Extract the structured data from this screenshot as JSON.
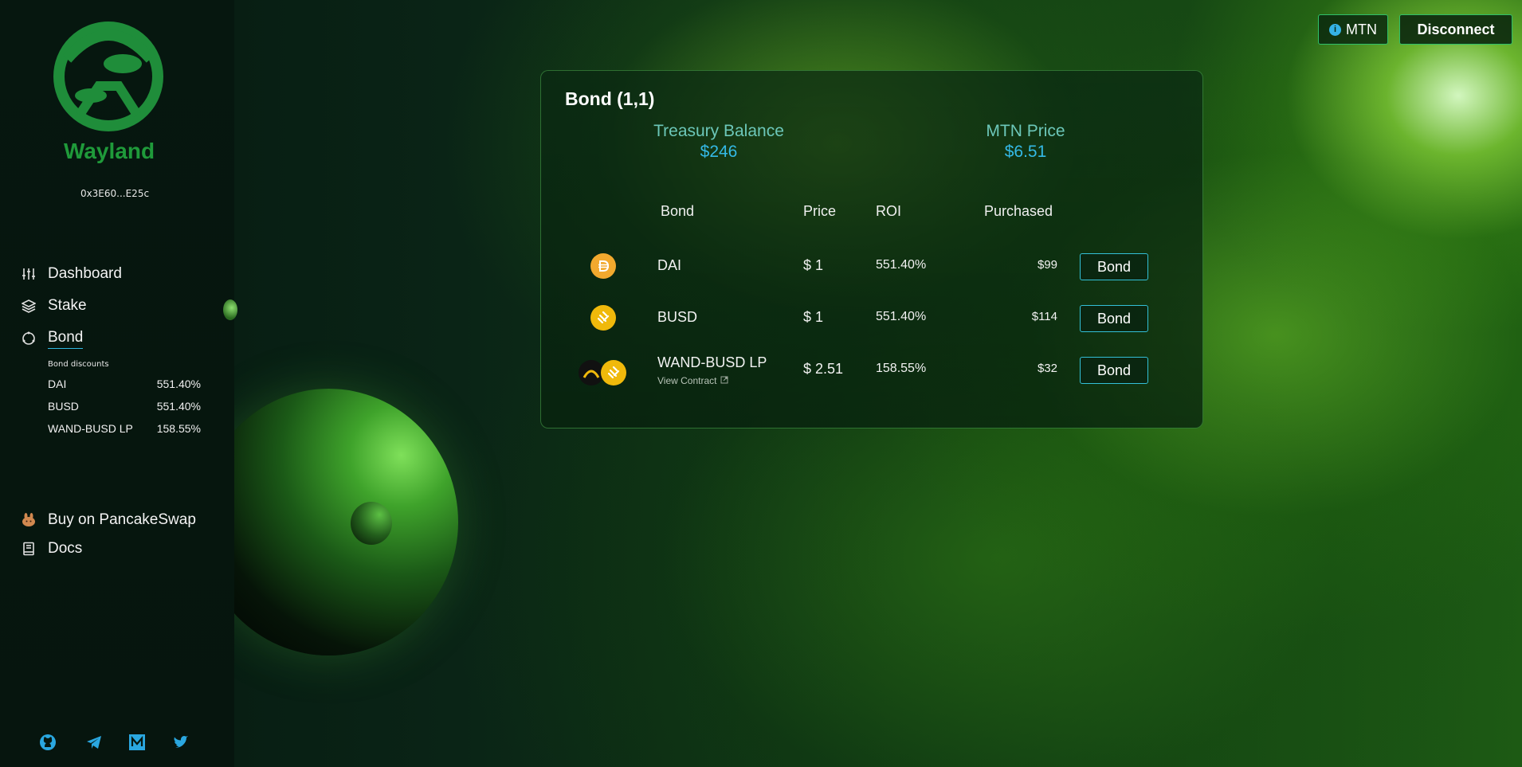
{
  "sidebar": {
    "brand": "Wayland",
    "address": "0x3E60...E25c",
    "nav": {
      "dashboard": "Dashboard",
      "stake": "Stake",
      "bond": "Bond",
      "pancakeswap": "Buy on PancakeSwap",
      "docs": "Docs"
    },
    "bond_discounts_title": "Bond discounts",
    "bond_discounts": [
      {
        "name": "DAI",
        "value": "551.40%"
      },
      {
        "name": "BUSD",
        "value": "551.40%"
      },
      {
        "name": "WAND-BUSD LP",
        "value": "158.55%"
      }
    ],
    "socials": [
      "github-icon",
      "telegram-icon",
      "medium-icon",
      "twitter-icon"
    ]
  },
  "header": {
    "token_button": "MTN",
    "disconnect_button": "Disconnect"
  },
  "card": {
    "title": "Bond (1,1)",
    "treasury_label": "Treasury Balance",
    "treasury_value": "$246",
    "price_label": "MTN Price",
    "price_value": "$6.51",
    "columns": {
      "bond": "Bond",
      "price": "Price",
      "roi": "ROI",
      "purchased": "Purchased"
    },
    "rows": [
      {
        "name": "DAI",
        "price": "$ 1",
        "roi": "551.40%",
        "purchased": "$99",
        "button": "Bond",
        "icon": "dai-icon"
      },
      {
        "name": "BUSD",
        "price": "$ 1",
        "roi": "551.40%",
        "purchased": "$114",
        "button": "Bond",
        "icon": "busd-icon"
      },
      {
        "name": "WAND-BUSD LP",
        "sub": "View Contract",
        "price": "$ 2.51",
        "roi": "158.55%",
        "purchased": "$32",
        "button": "Bond",
        "icon": "wand-busd-lp-icon"
      }
    ]
  },
  "colors": {
    "accent": "#34b9e6",
    "brand": "#1f9a3a",
    "label": "#6cc7b9",
    "border": "#2fc06a"
  }
}
